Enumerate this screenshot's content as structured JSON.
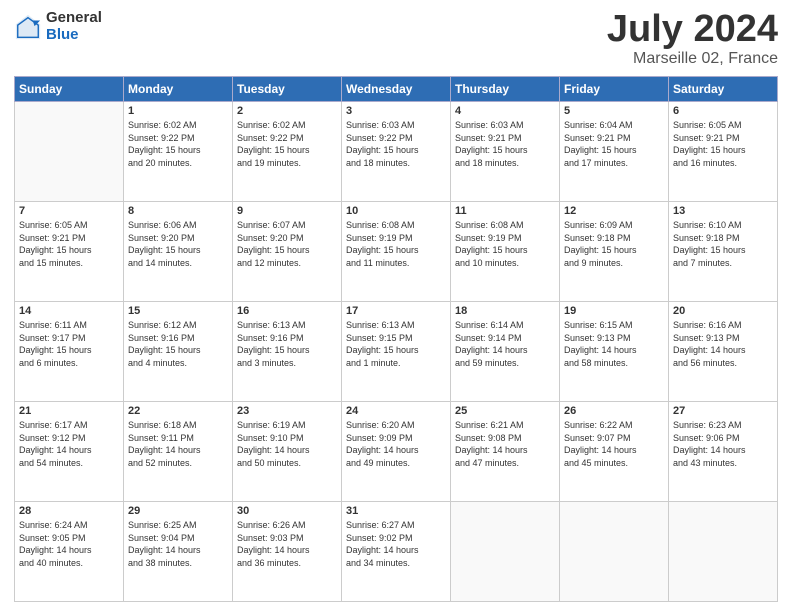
{
  "logo": {
    "general": "General",
    "blue": "Blue"
  },
  "title": "July 2024",
  "location": "Marseille 02, France",
  "days_of_week": [
    "Sunday",
    "Monday",
    "Tuesday",
    "Wednesday",
    "Thursday",
    "Friday",
    "Saturday"
  ],
  "weeks": [
    [
      {
        "day": "",
        "info": ""
      },
      {
        "day": "1",
        "info": "Sunrise: 6:02 AM\nSunset: 9:22 PM\nDaylight: 15 hours\nand 20 minutes."
      },
      {
        "day": "2",
        "info": "Sunrise: 6:02 AM\nSunset: 9:22 PM\nDaylight: 15 hours\nand 19 minutes."
      },
      {
        "day": "3",
        "info": "Sunrise: 6:03 AM\nSunset: 9:22 PM\nDaylight: 15 hours\nand 18 minutes."
      },
      {
        "day": "4",
        "info": "Sunrise: 6:03 AM\nSunset: 9:21 PM\nDaylight: 15 hours\nand 18 minutes."
      },
      {
        "day": "5",
        "info": "Sunrise: 6:04 AM\nSunset: 9:21 PM\nDaylight: 15 hours\nand 17 minutes."
      },
      {
        "day": "6",
        "info": "Sunrise: 6:05 AM\nSunset: 9:21 PM\nDaylight: 15 hours\nand 16 minutes."
      }
    ],
    [
      {
        "day": "7",
        "info": "Sunrise: 6:05 AM\nSunset: 9:21 PM\nDaylight: 15 hours\nand 15 minutes."
      },
      {
        "day": "8",
        "info": "Sunrise: 6:06 AM\nSunset: 9:20 PM\nDaylight: 15 hours\nand 14 minutes."
      },
      {
        "day": "9",
        "info": "Sunrise: 6:07 AM\nSunset: 9:20 PM\nDaylight: 15 hours\nand 12 minutes."
      },
      {
        "day": "10",
        "info": "Sunrise: 6:08 AM\nSunset: 9:19 PM\nDaylight: 15 hours\nand 11 minutes."
      },
      {
        "day": "11",
        "info": "Sunrise: 6:08 AM\nSunset: 9:19 PM\nDaylight: 15 hours\nand 10 minutes."
      },
      {
        "day": "12",
        "info": "Sunrise: 6:09 AM\nSunset: 9:18 PM\nDaylight: 15 hours\nand 9 minutes."
      },
      {
        "day": "13",
        "info": "Sunrise: 6:10 AM\nSunset: 9:18 PM\nDaylight: 15 hours\nand 7 minutes."
      }
    ],
    [
      {
        "day": "14",
        "info": "Sunrise: 6:11 AM\nSunset: 9:17 PM\nDaylight: 15 hours\nand 6 minutes."
      },
      {
        "day": "15",
        "info": "Sunrise: 6:12 AM\nSunset: 9:16 PM\nDaylight: 15 hours\nand 4 minutes."
      },
      {
        "day": "16",
        "info": "Sunrise: 6:13 AM\nSunset: 9:16 PM\nDaylight: 15 hours\nand 3 minutes."
      },
      {
        "day": "17",
        "info": "Sunrise: 6:13 AM\nSunset: 9:15 PM\nDaylight: 15 hours\nand 1 minute."
      },
      {
        "day": "18",
        "info": "Sunrise: 6:14 AM\nSunset: 9:14 PM\nDaylight: 14 hours\nand 59 minutes."
      },
      {
        "day": "19",
        "info": "Sunrise: 6:15 AM\nSunset: 9:13 PM\nDaylight: 14 hours\nand 58 minutes."
      },
      {
        "day": "20",
        "info": "Sunrise: 6:16 AM\nSunset: 9:13 PM\nDaylight: 14 hours\nand 56 minutes."
      }
    ],
    [
      {
        "day": "21",
        "info": "Sunrise: 6:17 AM\nSunset: 9:12 PM\nDaylight: 14 hours\nand 54 minutes."
      },
      {
        "day": "22",
        "info": "Sunrise: 6:18 AM\nSunset: 9:11 PM\nDaylight: 14 hours\nand 52 minutes."
      },
      {
        "day": "23",
        "info": "Sunrise: 6:19 AM\nSunset: 9:10 PM\nDaylight: 14 hours\nand 50 minutes."
      },
      {
        "day": "24",
        "info": "Sunrise: 6:20 AM\nSunset: 9:09 PM\nDaylight: 14 hours\nand 49 minutes."
      },
      {
        "day": "25",
        "info": "Sunrise: 6:21 AM\nSunset: 9:08 PM\nDaylight: 14 hours\nand 47 minutes."
      },
      {
        "day": "26",
        "info": "Sunrise: 6:22 AM\nSunset: 9:07 PM\nDaylight: 14 hours\nand 45 minutes."
      },
      {
        "day": "27",
        "info": "Sunrise: 6:23 AM\nSunset: 9:06 PM\nDaylight: 14 hours\nand 43 minutes."
      }
    ],
    [
      {
        "day": "28",
        "info": "Sunrise: 6:24 AM\nSunset: 9:05 PM\nDaylight: 14 hours\nand 40 minutes."
      },
      {
        "day": "29",
        "info": "Sunrise: 6:25 AM\nSunset: 9:04 PM\nDaylight: 14 hours\nand 38 minutes."
      },
      {
        "day": "30",
        "info": "Sunrise: 6:26 AM\nSunset: 9:03 PM\nDaylight: 14 hours\nand 36 minutes."
      },
      {
        "day": "31",
        "info": "Sunrise: 6:27 AM\nSunset: 9:02 PM\nDaylight: 14 hours\nand 34 minutes."
      },
      {
        "day": "",
        "info": ""
      },
      {
        "day": "",
        "info": ""
      },
      {
        "day": "",
        "info": ""
      }
    ]
  ]
}
